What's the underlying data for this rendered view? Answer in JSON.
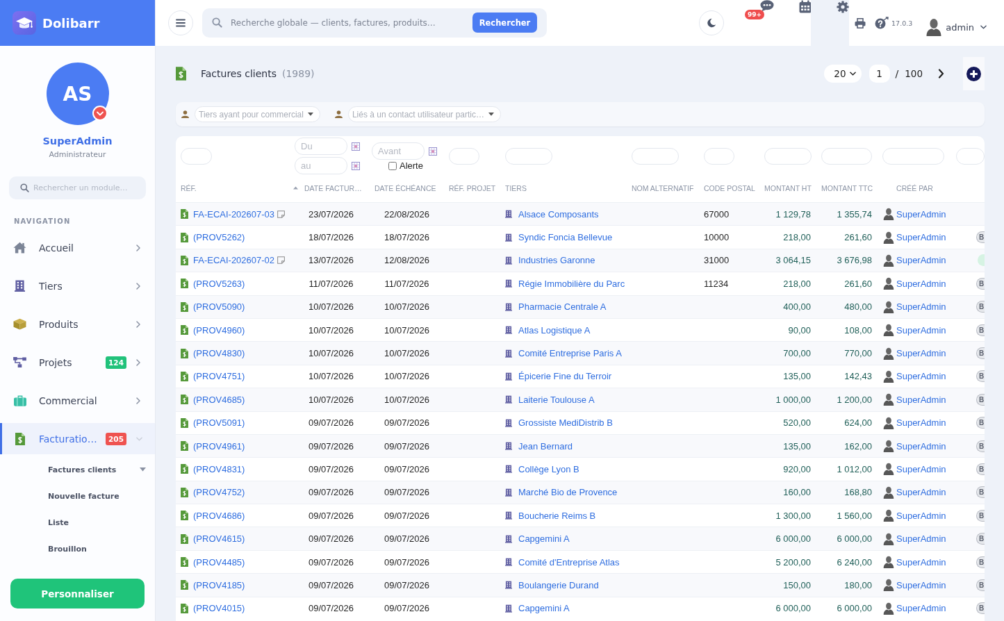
{
  "brand": {
    "name": "Dolibarr"
  },
  "sidebar": {
    "avatar": {
      "initials": "AS"
    },
    "user_name": "SuperAdmin",
    "user_role": "Administrateur",
    "search": {
      "placeholder": "Rechercher un module…"
    },
    "section_title": "NAVIGATION",
    "items": [
      {
        "label": "Accueil",
        "selected": false,
        "expanded": false
      },
      {
        "label": "Tiers",
        "selected": false,
        "expanded": false
      },
      {
        "label": "Produits",
        "selected": false,
        "expanded": false
      },
      {
        "label": "Projets",
        "badge": {
          "text": "124",
          "color": "#21c27b"
        },
        "selected": false,
        "expanded": false
      },
      {
        "label": "Commercial",
        "selected": false,
        "expanded": false
      },
      {
        "label": "Facturatio…",
        "badge": {
          "text": "205",
          "color": "#ef5350"
        },
        "selected": true,
        "expanded": true,
        "children": [
          {
            "label": "Factures clients",
            "expanded": true
          },
          {
            "label": "Nouvelle facture",
            "expanded": false
          },
          {
            "label": "Liste",
            "expanded": false
          },
          {
            "label": "Brouillon",
            "expanded": false
          }
        ]
      }
    ],
    "button": "Personnaliser"
  },
  "topbar": {
    "search": {
      "placeholder": "Recherche globale — clients, factures, produits…",
      "button": "Rechercher"
    },
    "notification_badge": "99+",
    "version": "17.0.3",
    "user": "admin"
  },
  "page": {
    "title": "Factures clients",
    "count": "(1989)",
    "pagination": {
      "per_page": "20",
      "page": "1",
      "separator": "/",
      "total": "100"
    }
  },
  "filters": [
    {
      "placeholder": "Tiers ayant pour commercial"
    },
    {
      "placeholder": "Liés à un contact utilisateur partic…"
    }
  ],
  "table": {
    "filters": [
      {
        "kind": "text"
      },
      {
        "kind": "date_range",
        "from_placeholder": "Du",
        "to_placeholder": "au"
      },
      {
        "kind": "date_alert",
        "placeholder": "Avant",
        "checkbox": {
          "label": "Alerte",
          "checked": false
        }
      },
      {
        "kind": "text"
      },
      {
        "kind": "text"
      },
      {
        "kind": "text"
      },
      {
        "kind": "text"
      },
      {
        "kind": "text"
      },
      {
        "kind": "text"
      },
      {
        "kind": "text"
      },
      {
        "kind": "text"
      }
    ],
    "columns": [
      {
        "label": "RÉF.",
        "sorted": false
      },
      {
        "label": "DATE FACTUR…",
        "sorted": true
      },
      {
        "label": "DATE ÉCHÉANCE",
        "sorted": false
      },
      {
        "label": "RÉF. PROJET",
        "sorted": false
      },
      {
        "label": "TIERS",
        "sorted": false
      },
      {
        "label": "NOM ALTERNATIF",
        "sorted": false
      },
      {
        "label": "CODE POSTAL",
        "sorted": false
      },
      {
        "label": "MONTANT HT",
        "sorted": false
      },
      {
        "label": "MONTANT TTC",
        "sorted": false
      },
      {
        "label": "CRÉÉ PAR",
        "sorted": false
      }
    ],
    "rows": [
      {
        "ref": "FA-ECAI-202607-03",
        "note": true,
        "date": "23/07/2026",
        "due_date": "22/08/2026",
        "thirdparty": "Alsace Composants",
        "postal_code": "67000",
        "amount_ht": "1 129,78",
        "amount_ttc": "1 355,74",
        "author": "SuperAdmin"
      },
      {
        "ref": "(PROV5262)",
        "note": false,
        "date": "18/07/2026",
        "due_date": "18/07/2026",
        "thirdparty": "Syndic Foncia Bellevue",
        "postal_code": "10000",
        "amount_ht": "218,00",
        "amount_ttc": "261,60",
        "author": "SuperAdmin",
        "status": {
          "label": "B",
          "color": "#e6e8ec"
        }
      },
      {
        "ref": "FA-ECAI-202607-02",
        "note": true,
        "date": "13/07/2026",
        "due_date": "12/08/2026",
        "thirdparty": "Industries Garonne",
        "postal_code": "31000",
        "amount_ht": "3 064,15",
        "amount_ttc": "3 676,98",
        "author": "SuperAdmin",
        "status": {
          "color": "#d6f3e3"
        }
      },
      {
        "ref": "(PROV5263)",
        "note": false,
        "date": "11/07/2026",
        "due_date": "11/07/2026",
        "thirdparty": "Régie Immobilière du Parc",
        "postal_code": "11234",
        "amount_ht": "218,00",
        "amount_ttc": "261,60",
        "author": "SuperAdmin",
        "status": {
          "label": "B",
          "color": "#e6e8ec"
        }
      },
      {
        "ref": "(PROV5090)",
        "note": false,
        "date": "10/07/2026",
        "due_date": "10/07/2026",
        "thirdparty": "Pharmacie Centrale A",
        "amount_ht": "400,00",
        "amount_ttc": "480,00",
        "author": "SuperAdmin",
        "status": {
          "label": "B",
          "color": "#e6e8ec"
        }
      },
      {
        "ref": "(PROV4960)",
        "note": false,
        "date": "10/07/2026",
        "due_date": "10/07/2026",
        "thirdparty": "Atlas Logistique A",
        "amount_ht": "90,00",
        "amount_ttc": "108,00",
        "author": "SuperAdmin",
        "status": {
          "label": "B",
          "color": "#e6e8ec"
        }
      },
      {
        "ref": "(PROV4830)",
        "note": false,
        "date": "10/07/2026",
        "due_date": "10/07/2026",
        "thirdparty": "Comité Entreprise Paris A",
        "amount_ht": "700,00",
        "amount_ttc": "770,00",
        "author": "SuperAdmin",
        "status": {
          "label": "B",
          "color": "#e6e8ec"
        }
      },
      {
        "ref": "(PROV4751)",
        "note": false,
        "date": "10/07/2026",
        "due_date": "10/07/2026",
        "thirdparty": "Épicerie Fine du Terroir",
        "amount_ht": "135,00",
        "amount_ttc": "142,43",
        "author": "SuperAdmin",
        "status": {
          "label": "B",
          "color": "#e6e8ec"
        }
      },
      {
        "ref": "(PROV4685)",
        "note": false,
        "date": "10/07/2026",
        "due_date": "10/07/2026",
        "thirdparty": "Laiterie Toulouse A",
        "amount_ht": "1 000,00",
        "amount_ttc": "1 200,00",
        "author": "SuperAdmin",
        "status": {
          "label": "B",
          "color": "#e6e8ec"
        }
      },
      {
        "ref": "(PROV5091)",
        "note": false,
        "date": "09/07/2026",
        "due_date": "09/07/2026",
        "thirdparty": "Grossiste MediDistrib B",
        "amount_ht": "520,00",
        "amount_ttc": "624,00",
        "author": "SuperAdmin",
        "status": {
          "label": "B",
          "color": "#e6e8ec"
        }
      },
      {
        "ref": "(PROV4961)",
        "note": false,
        "date": "09/07/2026",
        "due_date": "09/07/2026",
        "thirdparty": "Jean Bernard",
        "amount_ht": "135,00",
        "amount_ttc": "162,00",
        "author": "SuperAdmin",
        "status": {
          "label": "B",
          "color": "#e6e8ec"
        }
      },
      {
        "ref": "(PROV4831)",
        "note": false,
        "date": "09/07/2026",
        "due_date": "09/07/2026",
        "thirdparty": "Collège Lyon B",
        "amount_ht": "920,00",
        "amount_ttc": "1 012,00",
        "author": "SuperAdmin",
        "status": {
          "label": "B",
          "color": "#e6e8ec"
        }
      },
      {
        "ref": "(PROV4752)",
        "note": false,
        "date": "09/07/2026",
        "due_date": "09/07/2026",
        "thirdparty": "Marché Bio de Provence",
        "amount_ht": "160,00",
        "amount_ttc": "168,80",
        "author": "SuperAdmin",
        "status": {
          "label": "B",
          "color": "#e6e8ec"
        }
      },
      {
        "ref": "(PROV4686)",
        "note": false,
        "date": "09/07/2026",
        "due_date": "09/07/2026",
        "thirdparty": "Boucherie Reims B",
        "amount_ht": "1 300,00",
        "amount_ttc": "1 560,00",
        "author": "SuperAdmin",
        "status": {
          "label": "B",
          "color": "#e6e8ec"
        }
      },
      {
        "ref": "(PROV4615)",
        "note": false,
        "date": "09/07/2026",
        "due_date": "09/07/2026",
        "thirdparty": "Capgemini A",
        "amount_ht": "6 000,00",
        "amount_ttc": "6 000,00",
        "author": "SuperAdmin",
        "status": {
          "label": "B",
          "color": "#e6e8ec"
        }
      },
      {
        "ref": "(PROV4485)",
        "note": false,
        "date": "09/07/2026",
        "due_date": "09/07/2026",
        "thirdparty": "Comité d'Entreprise Atlas",
        "amount_ht": "5 200,00",
        "amount_ttc": "6 240,00",
        "author": "SuperAdmin",
        "status": {
          "label": "B",
          "color": "#e6e8ec"
        }
      },
      {
        "ref": "(PROV4185)",
        "note": false,
        "date": "09/07/2026",
        "due_date": "09/07/2026",
        "thirdparty": "Boulangerie Durand",
        "amount_ht": "150,00",
        "amount_ttc": "180,00",
        "author": "SuperAdmin",
        "status": {
          "label": "B",
          "color": "#e6e8ec"
        }
      },
      {
        "ref": "(PROV4015)",
        "note": false,
        "date": "09/07/2026",
        "due_date": "09/07/2026",
        "thirdparty": "Capgemini A",
        "amount_ht": "6 000,00",
        "amount_ttc": "6 000,00",
        "author": "SuperAdmin",
        "status": {
          "label": "B",
          "color": "#e6e8ec"
        }
      }
    ]
  }
}
